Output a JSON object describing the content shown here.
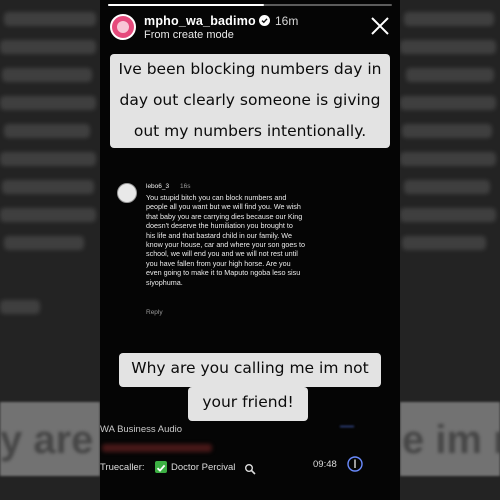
{
  "story": {
    "username": "mpho_wa_badimo",
    "time_ago": "16m",
    "subtitle": "From create mode",
    "progress": 0.55
  },
  "captions": {
    "top_line1": "Ive been blocking numbers day in",
    "top_line2": "day out clearly someone is giving",
    "top_line3": "out my numbers intentionally.",
    "bottom_line1": "Why are you calling me im not",
    "bottom_line2": "your friend!"
  },
  "comment": {
    "user": "lebo6_3",
    "time": "16s",
    "lines": [
      "You stupid bitch you can block numbers and",
      "people all you want but we will find you. We wish",
      "that baby you are carrying dies because our King",
      "doesn't deserve the humiliation you brought to",
      "his life and that bastard child in our family. We",
      "know your house, car and where your son goes to",
      "school, we will end you and we will not rest until",
      "you have fallen from your high horse. Are you",
      "even going to make it to Maputo ngoba leso sisu",
      "siyophuma."
    ],
    "reply_label": "Reply"
  },
  "bottom": {
    "wa_text": "WA Business Audio",
    "truecaller_label": "Truecaller:",
    "truecaller_name": "Doctor Percival",
    "clock": "09:48"
  },
  "backdrop": {
    "left_big": "y are",
    "right_big": "e im not"
  },
  "colors": {
    "caption_bg": "#e3e3e3",
    "avatar_ring": "#e64a7c",
    "check_green": "#3cb043"
  }
}
